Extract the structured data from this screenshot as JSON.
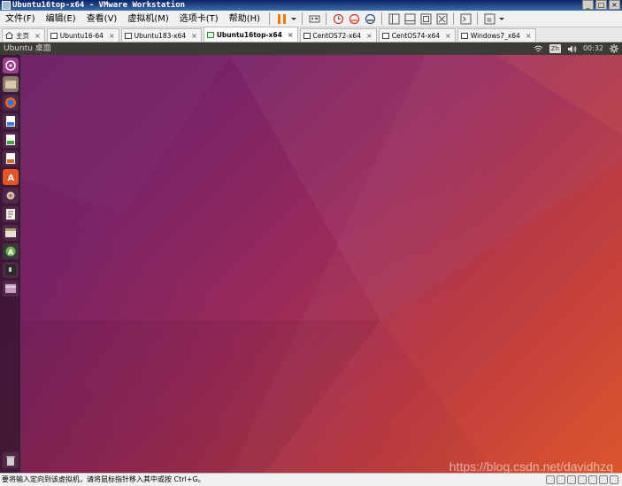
{
  "window": {
    "title": "Ubuntu16top-x64 - VMware Workstation",
    "controls": [
      "_",
      "□",
      "×"
    ]
  },
  "menu": [
    "文件(F)",
    "编辑(E)",
    "查看(V)",
    "虚拟机(M)",
    "选项卡(T)",
    "帮助(H)"
  ],
  "tabs": [
    {
      "label": "主页",
      "icon": "home-icon",
      "active": false
    },
    {
      "label": "Ubuntu16-64",
      "icon": "vm-icon",
      "active": false
    },
    {
      "label": "Ubuntu183-x64",
      "icon": "vm-icon",
      "active": false
    },
    {
      "label": "Ubuntu16top-x64",
      "icon": "vm-running-icon",
      "active": true
    },
    {
      "label": "CentOS72-x64",
      "icon": "vm-icon",
      "active": false
    },
    {
      "label": "CentOS74-x64",
      "icon": "vm-icon",
      "active": false
    },
    {
      "label": "Windows7_x64",
      "icon": "vm-icon",
      "active": false
    }
  ],
  "ubuntu_panel": {
    "title": "Ubuntu 桌面",
    "input_method": "Zh",
    "clock": "00:32"
  },
  "launcher": [
    "ubuntu-dash-icon",
    "files-icon",
    "firefox-icon",
    "writer-icon",
    "calc-icon",
    "impress-icon",
    "software-center-icon",
    "settings-icon",
    "text-editor-icon",
    "manager-icon",
    "update-icon",
    "terminal-icon",
    "workspace-icon",
    "trash-icon"
  ],
  "statusbar": {
    "text": "要将输入定向到该虚拟机，请将鼠标指针移入其中或按 Ctrl+G。"
  },
  "watermark": "https://blog.csdn.net/davidhzq",
  "colors": {
    "desktop_start": "#6d2167",
    "desktop_end": "#d8542b",
    "panel": "#3c3b37"
  }
}
